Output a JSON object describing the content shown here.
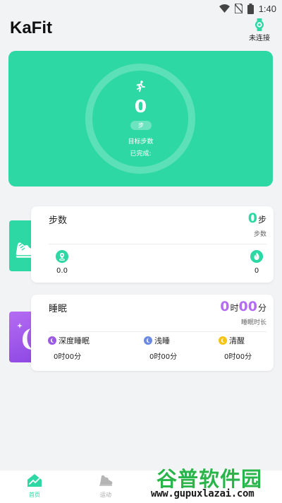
{
  "status_bar": {
    "time": "1:40"
  },
  "header": {
    "app_title": "KaFit",
    "device_status": "未连接"
  },
  "hero": {
    "step_count": "0",
    "step_unit": "步",
    "goal_label": "目标步数",
    "completed_label": "已完成:",
    "accent_color": "#2ed8a4"
  },
  "steps_card": {
    "title": "步数",
    "value": "0",
    "unit": "步",
    "caption": "步数",
    "distance_value": "0.0",
    "calories_value": "0",
    "icons": [
      "sneaker-icon",
      "location-icon",
      "flame-icon"
    ]
  },
  "sleep_card": {
    "title": "睡眠",
    "hours": "0",
    "hours_unit": "时",
    "minutes": "00",
    "minutes_unit": "分",
    "caption": "睡眠时长",
    "deep": {
      "label": "深度睡眠",
      "value": "0时00分",
      "color": "#9b59e6"
    },
    "light": {
      "label": "浅睡",
      "value": "0时00分",
      "color": "#6b8ae6"
    },
    "awake": {
      "label": "清醒",
      "value": "0时00分",
      "color": "#f5c518"
    },
    "accent_color": "#b46cf2"
  },
  "tab_bar": {
    "tabs": [
      {
        "label": "首页",
        "active": true,
        "icon": "chart-home-icon"
      },
      {
        "label": "运动",
        "active": false,
        "icon": "shoe-icon"
      }
    ]
  },
  "watermark": {
    "main": "谷普软件园",
    "url": "www.gupuxlazai.com"
  }
}
